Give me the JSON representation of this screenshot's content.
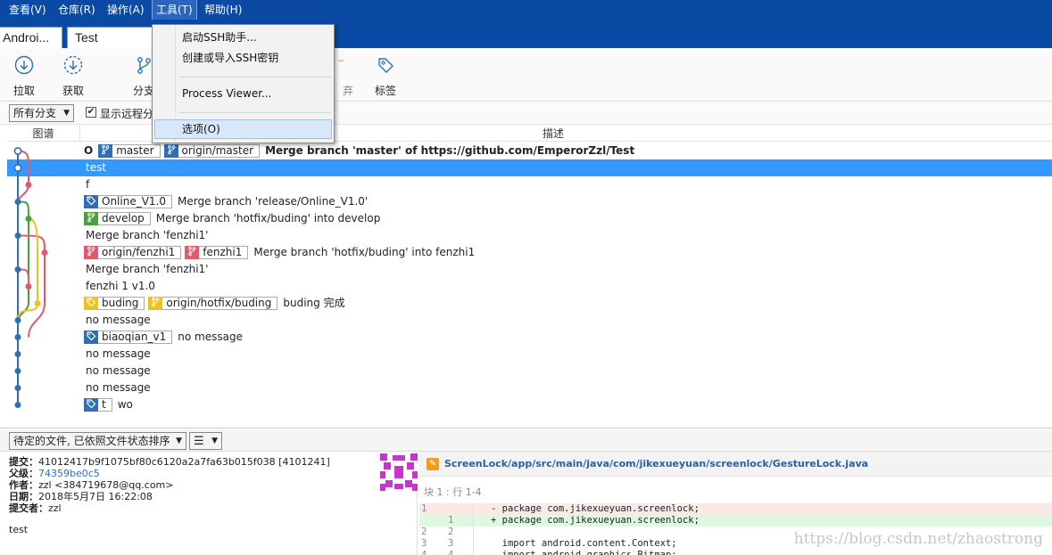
{
  "menubar": {
    "items": [
      "查看(V)",
      "仓库(R)",
      "操作(A)",
      "工具(T)",
      "帮助(H)"
    ],
    "active": "工具(T)"
  },
  "tabs": [
    "Androi...",
    "Test"
  ],
  "toolbar": {
    "pull": "拉取",
    "fetch": "获取",
    "branch": "分支",
    "discard_partial": "弃",
    "tag": "标签"
  },
  "tools_menu": {
    "items": [
      "启动SSH助手...",
      "创建或导入SSH密钥",
      "Process Viewer...",
      "选项(O)"
    ],
    "highlighted": "选项(O)"
  },
  "filter": {
    "branch_select": "所有分支",
    "show_remote_label": "显示远程分支",
    "show_remote_checked": true
  },
  "columns": {
    "graph": "图谱",
    "description": "描述"
  },
  "commits": [
    {
      "head": true,
      "working_marker": "O",
      "refs": [
        {
          "type": "branch",
          "color": "#2f6fb5",
          "name": "master"
        },
        {
          "type": "branch",
          "color": "#2f6fb5",
          "name": "origin/master"
        }
      ],
      "message": "Merge branch 'master' of https://github.com/EmperorZzl/Test"
    },
    {
      "selected": true,
      "refs": [],
      "message": "test"
    },
    {
      "refs": [],
      "message": "f"
    },
    {
      "refs": [
        {
          "type": "tag",
          "color": "#2f6fb5",
          "name": "Online_V1.0"
        }
      ],
      "message": "Merge branch 'release/Online_V1.0'"
    },
    {
      "refs": [
        {
          "type": "branch",
          "color": "#4aa13a",
          "name": "develop"
        }
      ],
      "message": "Merge branch 'hotfix/buding' into develop"
    },
    {
      "refs": [],
      "message": "Merge branch 'fenzhi1'"
    },
    {
      "refs": [
        {
          "type": "branch",
          "color": "#e05a6d",
          "name": "origin/fenzhi1"
        },
        {
          "type": "branch",
          "color": "#e05a6d",
          "name": "fenzhi1"
        }
      ],
      "message": "Merge branch 'hotfix/buding' into fenzhi1"
    },
    {
      "refs": [],
      "message": "Merge branch 'fenzhi1'"
    },
    {
      "refs": [],
      "message": "fenzhi 1  v1.0"
    },
    {
      "refs": [
        {
          "type": "tag",
          "color": "#f0c020",
          "name": "buding"
        },
        {
          "type": "branch",
          "color": "#f0c020",
          "name": "origin/hotfix/buding"
        }
      ],
      "message": "buding 完成"
    },
    {
      "refs": [],
      "message": "no message"
    },
    {
      "refs": [
        {
          "type": "tag",
          "color": "#2f6fb5",
          "name": "biaoqian_v1"
        }
      ],
      "message": "no message"
    },
    {
      "refs": [],
      "message": "no message"
    },
    {
      "refs": [],
      "message": "no message"
    },
    {
      "refs": [],
      "message": "no message"
    },
    {
      "refs": [
        {
          "type": "tag",
          "color": "#2f6fb5",
          "name": "t"
        }
      ],
      "message": "wo"
    }
  ],
  "status": {
    "file_sort": "待定的文件, 已依照文件状态排序",
    "view_mode_icon": "list-icon"
  },
  "commit_details": {
    "commit_label": "提交：",
    "commit_value": "41012417b9f1075bf80c6120a2a7fa63b015f038 [4101241]",
    "parent_label": "父级：",
    "parent_value": "74359be0c5",
    "author_label": "作者：",
    "author_value": "zzl <384719678@qq.com>",
    "date_label": "日期：",
    "date_value": "2018年5月7日 16:22:08",
    "committer_label": "提交者：",
    "committer_value": "zzl",
    "message": "test"
  },
  "diff": {
    "file_path": "ScreenLock/app/src/main/java/com/jikexueyuan/screenlock/GestureLock.java",
    "hunk_header": "块 1 : 行 1-4",
    "lines": [
      {
        "old": "1",
        "new": "",
        "kind": "del",
        "text": "- package com.jikexueyuan.screenlock;"
      },
      {
        "old": "",
        "new": "1",
        "kind": "add",
        "text": "+ package com.jikexueyuan.screenlock;"
      },
      {
        "old": "2",
        "new": "2",
        "kind": "ctx",
        "text": ""
      },
      {
        "old": "3",
        "new": "3",
        "kind": "ctx",
        "text": "  import android.content.Context;"
      },
      {
        "old": "4",
        "new": "4",
        "kind": "ctx",
        "text": "  import android.graphics.Bitmap;"
      }
    ]
  },
  "watermark": "https://blog.csdn.net/zhaostrong",
  "colors": {
    "chrome_blue": "#0a4aa5",
    "selection": "#3399ff",
    "lane_blue": "#2f6fb5",
    "lane_red": "#e05a6d",
    "lane_green": "#4aa13a",
    "lane_yellow": "#f0c020"
  }
}
